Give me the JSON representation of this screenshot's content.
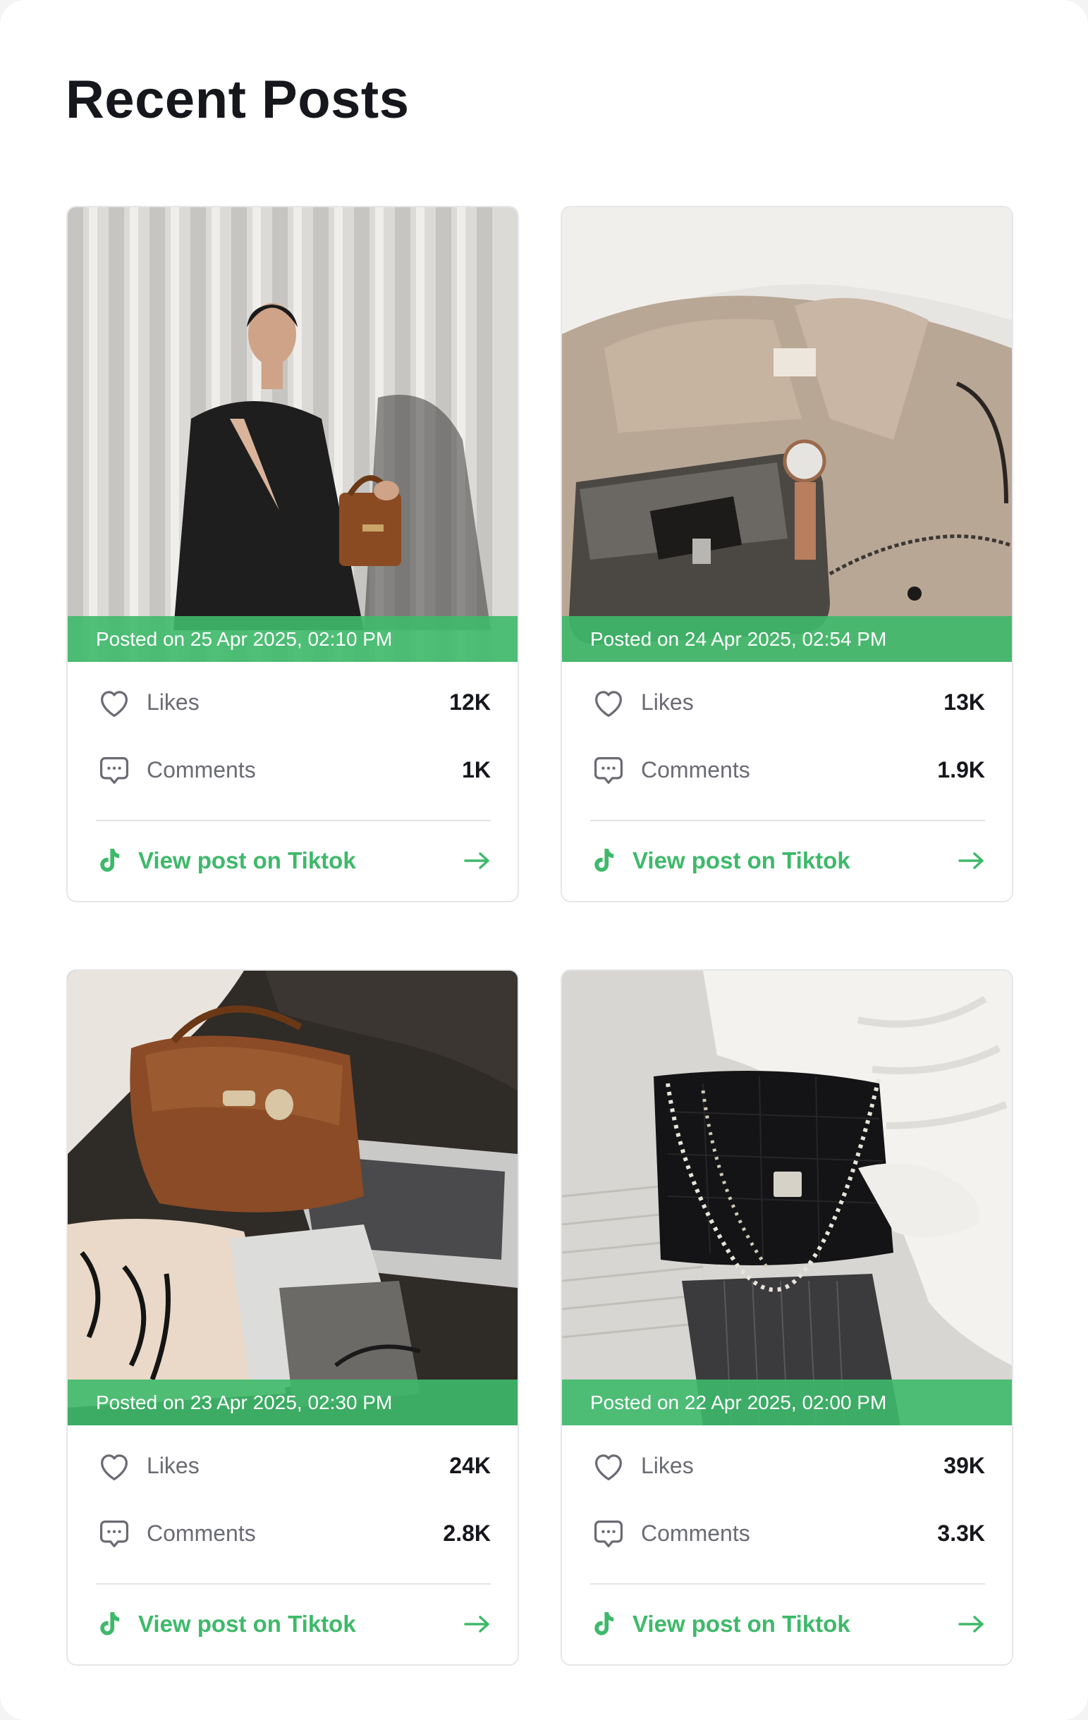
{
  "page": {
    "title": "Recent Posts"
  },
  "colors": {
    "accent": "#3EB96A",
    "text_primary": "#16171C",
    "text_secondary": "#6A6B73",
    "border": "#E6E7EA"
  },
  "labels": {
    "likes": "Likes",
    "comments": "Comments",
    "view_post": "View post on Tiktok"
  },
  "posts": [
    {
      "posted": "Posted on 25 Apr 2025, 02:10 PM",
      "likes": "12K",
      "comments": "1K",
      "image": "woman in black blazer holding brown handbag against white striped wall"
    },
    {
      "posted": "Posted on 24 Apr 2025, 02:54 PM",
      "likes": "13K",
      "comments": "1.9K",
      "image": "beige trench coat with dark handbag and wristwatch"
    },
    {
      "posted": "Posted on 23 Apr 2025, 02:30 PM",
      "likes": "24K",
      "comments": "2.8K",
      "image": "brown leather handbag on laptop with magazines"
    },
    {
      "posted": "Posted on 22 Apr 2025, 02:00 PM",
      "likes": "39K",
      "comments": "3.3K",
      "image": "black quilted handbag with pearl chain held by person in white sweater"
    }
  ]
}
